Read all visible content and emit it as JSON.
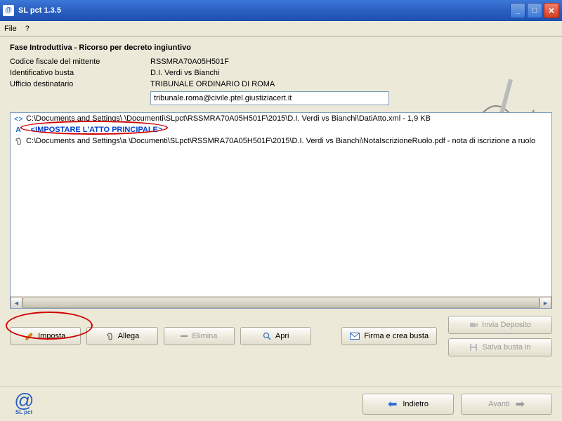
{
  "window": {
    "title": "SL pct 1.3.5"
  },
  "menu": {
    "file": "File",
    "help": "?"
  },
  "header": {
    "phase": "Fase Introduttiva - Ricorso per decreto ingiuntivo"
  },
  "info": {
    "codice_label": "Codice fiscale del mittente",
    "codice_value": "RSSMRA70A05H501F",
    "busta_label": "Identificativo busta",
    "busta_value": "D.I. Verdi vs Bianchi",
    "ufficio_label": "Ufficio destinatario",
    "ufficio_value": "TRIBUNALE ORDINARIO DI ROMA",
    "email_value": "tribunale.roma@civile.ptel.giustiziacert.it"
  },
  "files": [
    {
      "icon": "xml",
      "text": "C:\\Documents and Settings\\            \\Documenti\\SLpct\\RSSMRA70A05H501F\\2015\\D.I. Verdi vs Bianchi\\DatiAtto.xml - 1,9 KB"
    },
    {
      "icon": "placeholder",
      "text": "- <IMPOSTARE L'ATTO PRINCIPALE>"
    },
    {
      "icon": "clip",
      "text": "C:\\Documents and Settings\\a           \\Documenti\\SLpct\\RSSMRA70A05H501F\\2015\\D.I. Verdi vs Bianchi\\NotaIscrizioneRuolo.pdf - nota di iscrizione a ruolo"
    }
  ],
  "buttons": {
    "imposta": "Imposta",
    "allega": "Allega",
    "elimina": "Elimina",
    "apri": "Apri",
    "firma": "Firma e crea busta",
    "invia": "Invia Deposito",
    "salva": "Salva busta in"
  },
  "nav": {
    "indietro": "Indietro",
    "avanti": "Avanti"
  },
  "logo": {
    "text": "SL pct"
  }
}
